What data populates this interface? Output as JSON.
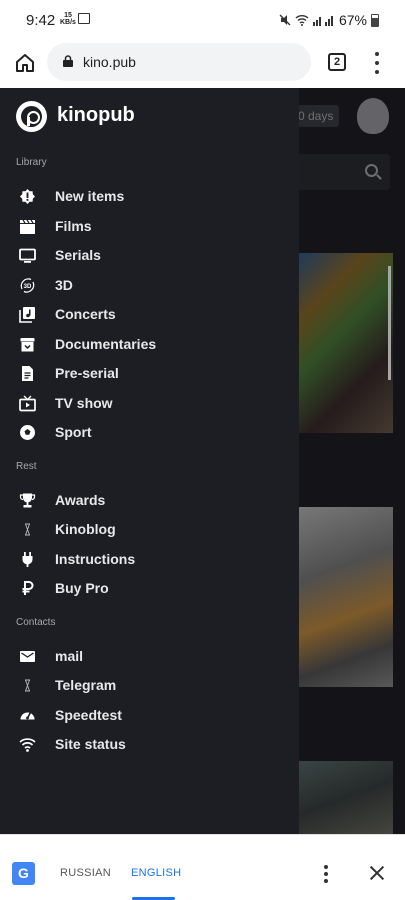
{
  "status_bar": {
    "time": "9:42",
    "speed_value": "15",
    "speed_unit": "KB/s",
    "battery": "67%"
  },
  "browser": {
    "url": "kino.pub",
    "tab_count": "2"
  },
  "page": {
    "days_badge": "0 days"
  },
  "drawer": {
    "brand": "kinopub",
    "sections": {
      "library": "Library",
      "rest": "Rest",
      "contacts": "Contacts"
    },
    "library_items": [
      {
        "label": "New items",
        "icon": "alert-icon"
      },
      {
        "label": "Films",
        "icon": "clapperboard-icon"
      },
      {
        "label": "Serials",
        "icon": "tv-icon"
      },
      {
        "label": "3D",
        "icon": "3d-rotation-icon"
      },
      {
        "label": "Concerts",
        "icon": "music-library-icon"
      },
      {
        "label": "Documentaries",
        "icon": "archive-icon"
      },
      {
        "label": "Pre-serial",
        "icon": "document-icon"
      },
      {
        "label": "TV show",
        "icon": "live-tv-icon"
      },
      {
        "label": "Sport",
        "icon": "soccer-ball-icon"
      }
    ],
    "rest_items": [
      {
        "label": "Awards",
        "icon": "trophy-icon"
      },
      {
        "label": "Kinoblog",
        "icon": "hourglass-icon"
      },
      {
        "label": "Instructions",
        "icon": "power-plug-icon"
      },
      {
        "label": "Buy Pro",
        "icon": "ruble-icon"
      }
    ],
    "contact_items": [
      {
        "label": "mail",
        "icon": "mail-icon"
      },
      {
        "label": "Telegram",
        "icon": "hourglass-icon"
      },
      {
        "label": "Speedtest",
        "icon": "speedometer-icon"
      },
      {
        "label": "Site status",
        "icon": "wifi-icon"
      }
    ]
  },
  "translate_bar": {
    "lang_from": "RUSSIAN",
    "lang_to": "ENGLISH"
  },
  "colors": {
    "drawer_bg": "#1c1e23",
    "accent": "#1a73e8"
  }
}
